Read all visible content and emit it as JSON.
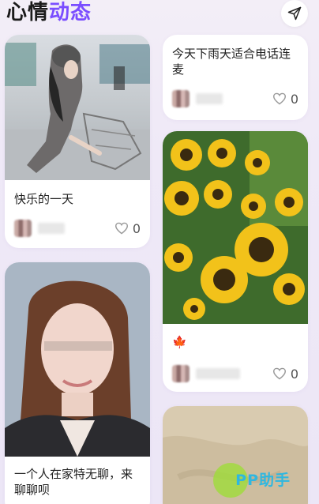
{
  "header": {
    "title_part1": "心情",
    "title_part2": "动态",
    "send_icon": "send-icon"
  },
  "posts": [
    {
      "caption": "快乐的一天",
      "likes": "0",
      "image": "photo of girl in cap pushing shopping cart"
    },
    {
      "caption": "今天下雨天适合电话连麦",
      "likes": "0"
    },
    {
      "caption": "🍁",
      "likes": "0",
      "image": "sunflowers photo"
    },
    {
      "caption": "一个人在家特无聊，来聊聊呗",
      "likes": "",
      "image": "portrait of girl"
    },
    {
      "caption": "",
      "likes": "",
      "image": "blurred fabric photo"
    }
  ],
  "watermark": {
    "text": "PP助手"
  },
  "colors": {
    "accent": "#7a4dff",
    "watermark": "#2fb7e0"
  }
}
